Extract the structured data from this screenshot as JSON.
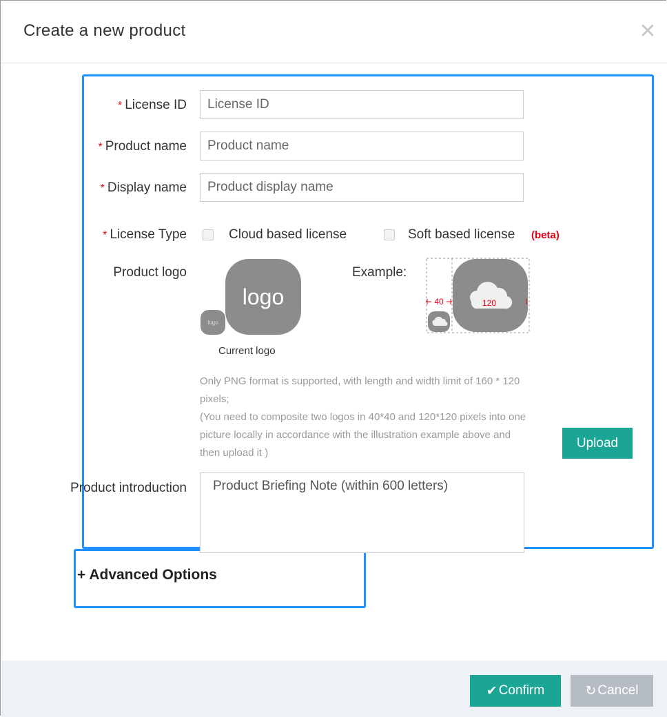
{
  "dialog": {
    "title": "Create a new product",
    "close_icon": "close-icon",
    "close_glyph": "✕"
  },
  "form": {
    "license_id": {
      "label": "License ID",
      "placeholder": "License ID",
      "value": ""
    },
    "product_name": {
      "label": "Product name",
      "placeholder": "Product name",
      "value": ""
    },
    "display_name": {
      "label": "Display name",
      "placeholder": "Product display name",
      "value": ""
    },
    "required_mark": "*",
    "license_type": {
      "label": "License Type",
      "options": [
        {
          "label": "Cloud based license",
          "checked": false
        },
        {
          "label": "Soft based license",
          "checked": false
        }
      ],
      "beta_label": "(beta)"
    },
    "product_logo": {
      "label": "Product logo",
      "logo_text": "logo",
      "small_logo_text": "logo",
      "current_logo_caption": "Current logo",
      "example_label": "Example:",
      "example_small_size": "40",
      "example_large_size": "120",
      "hint_lines": [
        "Only PNG format is supported, with length and width limit of 160 * 120 pixels;",
        "(You need to composite two logos in 40*40 and 120*120 pixels into one picture locally in accordance with the illustration example above and then upload it )"
      ],
      "upload_button": "Upload"
    },
    "product_introduction": {
      "label": "Product introduction",
      "placeholder": "Product Briefing Note (within 600 letters)",
      "value": ""
    },
    "advanced_options": {
      "icon": "plus-icon",
      "glyph": "+",
      "label": "Advanced Options"
    }
  },
  "footer": {
    "confirm_button": "Confirm",
    "confirm_glyph": "✔",
    "cancel_button": "Cancel",
    "cancel_glyph": "↻"
  },
  "colors": {
    "accent": "#1aa595",
    "required": "#e60012",
    "highlight": "#1e90ff",
    "cancel": "#b5bcc4",
    "footer_bg": "#eef1f6"
  }
}
